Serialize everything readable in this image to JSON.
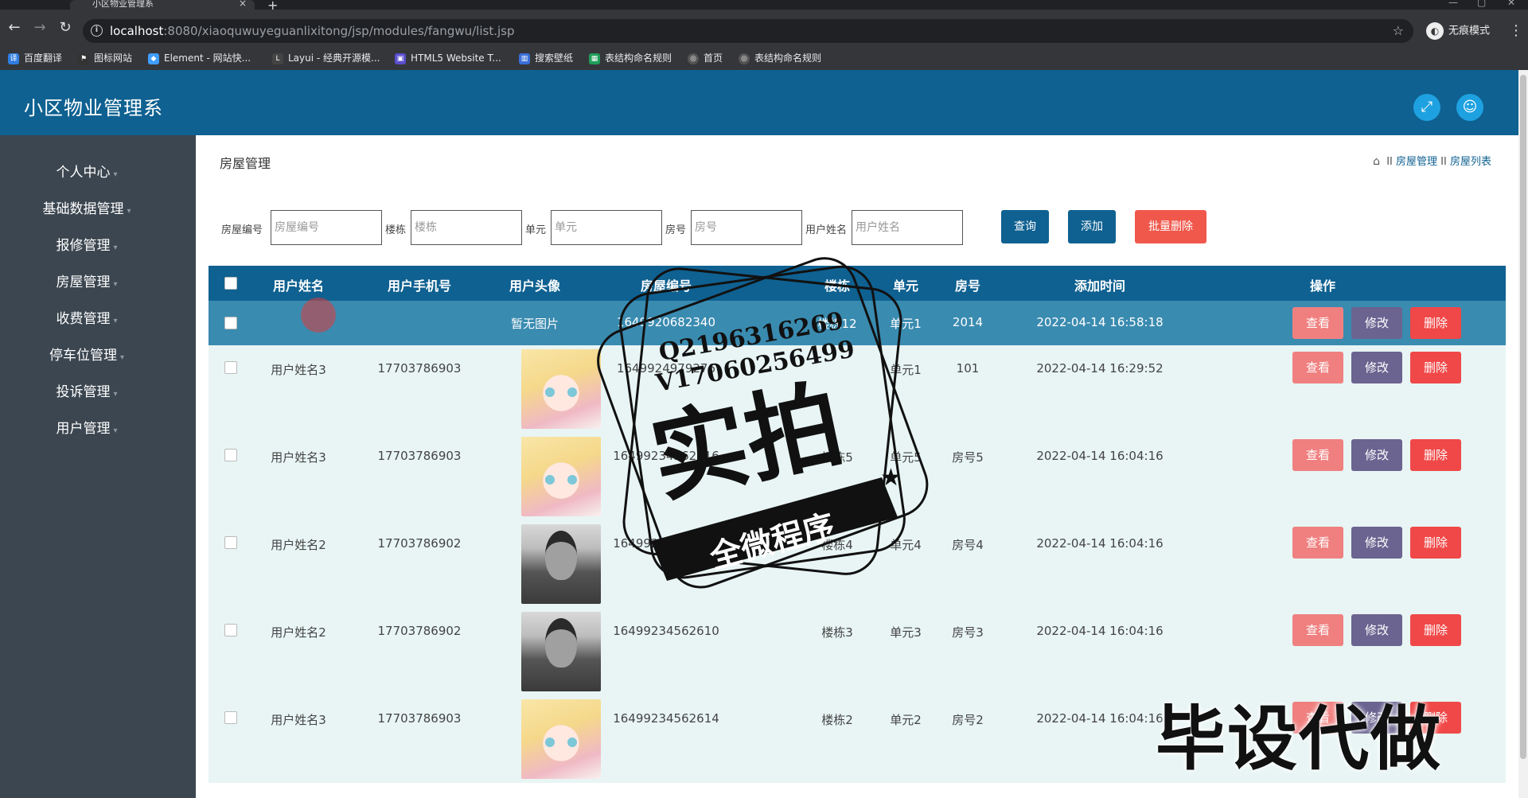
{
  "browser": {
    "tab_title": "小区物业管理系",
    "url_host": "localhost",
    "url_path": ":8080/xiaoquwuyeguanlixitong/jsp/modules/fangwu/list.jsp",
    "incognito_label": "无痕模式",
    "bookmarks": [
      {
        "label": "百度翻译",
        "color": "#2f7de1"
      },
      {
        "label": "图标网站",
        "color": "#333333"
      },
      {
        "label": "Element - 网站快...",
        "color": "#409eff"
      },
      {
        "label": "Layui - 经典开源模...",
        "color": "#444444"
      },
      {
        "label": "HTML5 Website T...",
        "color": "#5a4fcf"
      },
      {
        "label": "搜索壁纸",
        "color": "#3a6fd8"
      },
      {
        "label": "表结构命名规则",
        "color": "#1e9e5a"
      },
      {
        "label": "首页",
        "color": "#555555"
      },
      {
        "label": "表结构命名规则",
        "color": "#555555"
      }
    ]
  },
  "app": {
    "title": "小区物业管理系",
    "header_icons": [
      "expand-icon",
      "user-icon"
    ]
  },
  "sidebar": {
    "items": [
      "个人中心",
      "基础数据管理",
      "报修管理",
      "房屋管理",
      "收费管理",
      "停车位管理",
      "投诉管理",
      "用户管理"
    ]
  },
  "page": {
    "title": "房屋管理",
    "breadcrumb": [
      "房屋管理",
      "房屋列表"
    ],
    "breadcrumb_sep": "II"
  },
  "search": {
    "fields": [
      {
        "label": "房屋编号",
        "placeholder": "房屋编号"
      },
      {
        "label": "楼栋",
        "placeholder": "楼栋"
      },
      {
        "label": "单元",
        "placeholder": "单元"
      },
      {
        "label": "房号",
        "placeholder": "房号"
      },
      {
        "label": "用户姓名",
        "placeholder": "用户姓名"
      }
    ],
    "query_label": "查询",
    "add_label": "添加",
    "batch_delete_label": "批量删除"
  },
  "table": {
    "headers": [
      "用户姓名",
      "用户手机号",
      "用户头像",
      "房屋编号",
      "楼栋",
      "单元",
      "房号",
      "添加时间",
      "操作"
    ],
    "action_labels": {
      "view": "查看",
      "edit": "修改",
      "delete": "删除"
    },
    "rows": [
      {
        "name": "",
        "phone": "",
        "avatar": "暂无图片",
        "avatar_type": "none",
        "house_no": "1649920682340",
        "building": "楼栋12",
        "unit": "单元1",
        "room": "2014",
        "time": "2022-04-14 16:58:18"
      },
      {
        "name": "用户姓名3",
        "phone": "17703786903",
        "avatar": "",
        "avatar_type": "anime",
        "house_no": "1649924979276",
        "building": "",
        "unit": "单元1",
        "room": "101",
        "time": "2022-04-14 16:29:52"
      },
      {
        "name": "用户姓名3",
        "phone": "17703786903",
        "avatar": "",
        "avatar_type": "anime",
        "house_no": "16499234562616",
        "building": "楼栋5",
        "unit": "单元5",
        "room": "房号5",
        "time": "2022-04-14 16:04:16"
      },
      {
        "name": "用户姓名2",
        "phone": "17703786902",
        "avatar": "",
        "avatar_type": "photo",
        "house_no": "16499234562610",
        "building": "楼栋4",
        "unit": "单元4",
        "room": "房号4",
        "time": "2022-04-14 16:04:16"
      },
      {
        "name": "用户姓名2",
        "phone": "17703786902",
        "avatar": "",
        "avatar_type": "photo",
        "house_no": "16499234562610",
        "building": "楼栋3",
        "unit": "单元3",
        "room": "房号3",
        "time": "2022-04-14 16:04:16"
      },
      {
        "name": "用户姓名3",
        "phone": "17703786903",
        "avatar": "",
        "avatar_type": "anime",
        "house_no": "16499234562614",
        "building": "楼栋2",
        "unit": "单元2",
        "room": "房号2",
        "time": "2022-04-14 16:04:16"
      }
    ]
  },
  "watermark": {
    "stamp_line1": "Q2196316269",
    "stamp_line2": "V17060256499",
    "stamp_main": "实拍",
    "stamp_band": "全微程序",
    "bottom": "毕设代做"
  },
  "colors": {
    "header": "#0f6191",
    "sidebar": "#3b4650",
    "row_bg": "#e8f5f4",
    "selected_row": "#3a8bb0",
    "danger": "#f04848"
  }
}
